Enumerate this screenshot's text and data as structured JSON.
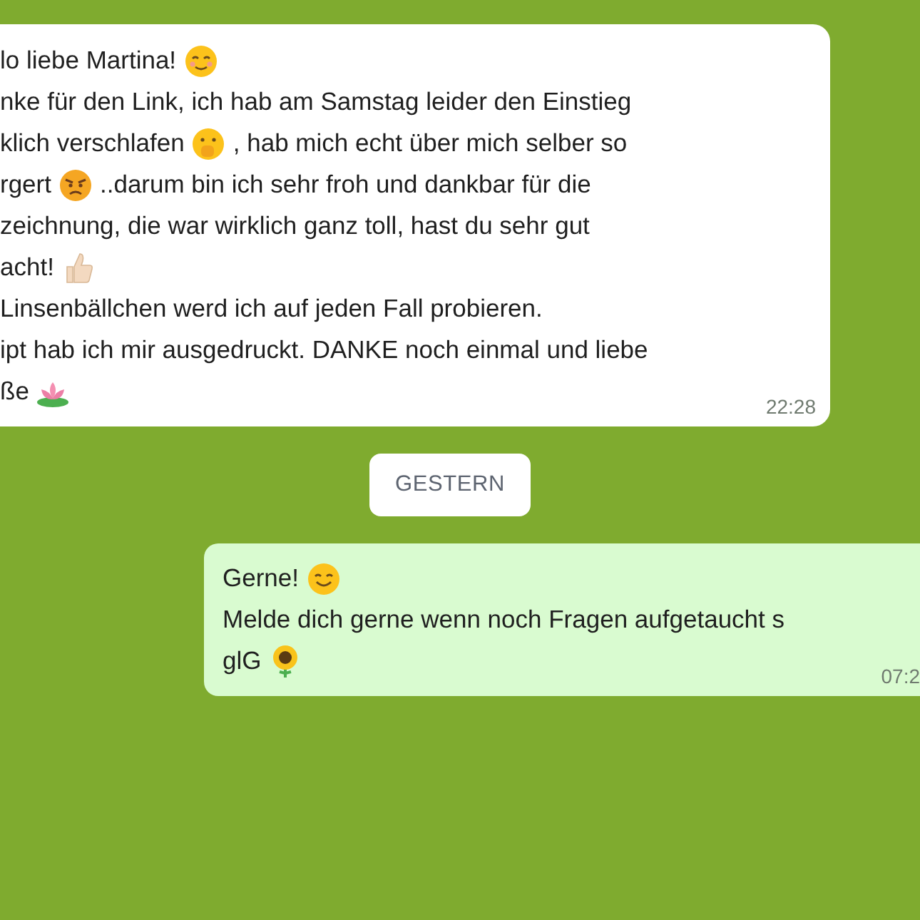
{
  "messages": [
    {
      "kind": "incoming",
      "lines": [
        [
          {
            "kind": "text",
            "text": "lo liebe Martina!"
          },
          {
            "kind": "emoji"
          }
        ],
        [
          {
            "kind": "text",
            "text": "nke für den Link, ich hab am Samstag leider den Einstieg"
          }
        ],
        [
          {
            "kind": "text",
            "text": "klich verschlafen"
          },
          {
            "kind": "emoji"
          },
          {
            "kind": "text",
            "text": ", hab mich echt über mich selber so"
          }
        ],
        [
          {
            "kind": "text",
            "text": "rgert"
          },
          {
            "kind": "emoji"
          },
          {
            "kind": "text",
            "text": "..darum bin ich sehr froh und dankbar für die"
          }
        ],
        [
          {
            "kind": "text",
            "text": "zeichnung, die war wirklich ganz toll, hast du sehr gut"
          }
        ],
        [
          {
            "kind": "text",
            "text": "acht!"
          },
          {
            "kind": "emoji"
          }
        ],
        [
          {
            "kind": "text",
            "text": "Linsenbällchen werd ich auf jeden Fall probieren."
          }
        ],
        [
          {
            "kind": "text",
            "text": "ipt hab ich mir ausgedruckt. DANKE noch einmal und liebe"
          }
        ],
        [
          {
            "kind": "text",
            "text": "ße"
          },
          {
            "kind": "emoji"
          }
        ]
      ],
      "time": "22:28"
    },
    {
      "kind": "date",
      "label": "GESTERN"
    },
    {
      "kind": "outgoing",
      "lines": [
        [
          {
            "kind": "text",
            "text": "Gerne!"
          },
          {
            "kind": "emoji"
          }
        ],
        [
          {
            "kind": "text",
            "text": "Melde dich gerne wenn noch Fragen aufgetaucht s"
          }
        ],
        [
          {
            "kind": "text",
            "text": "glG"
          },
          {
            "kind": "emoji"
          }
        ]
      ],
      "time": "07:2"
    }
  ]
}
